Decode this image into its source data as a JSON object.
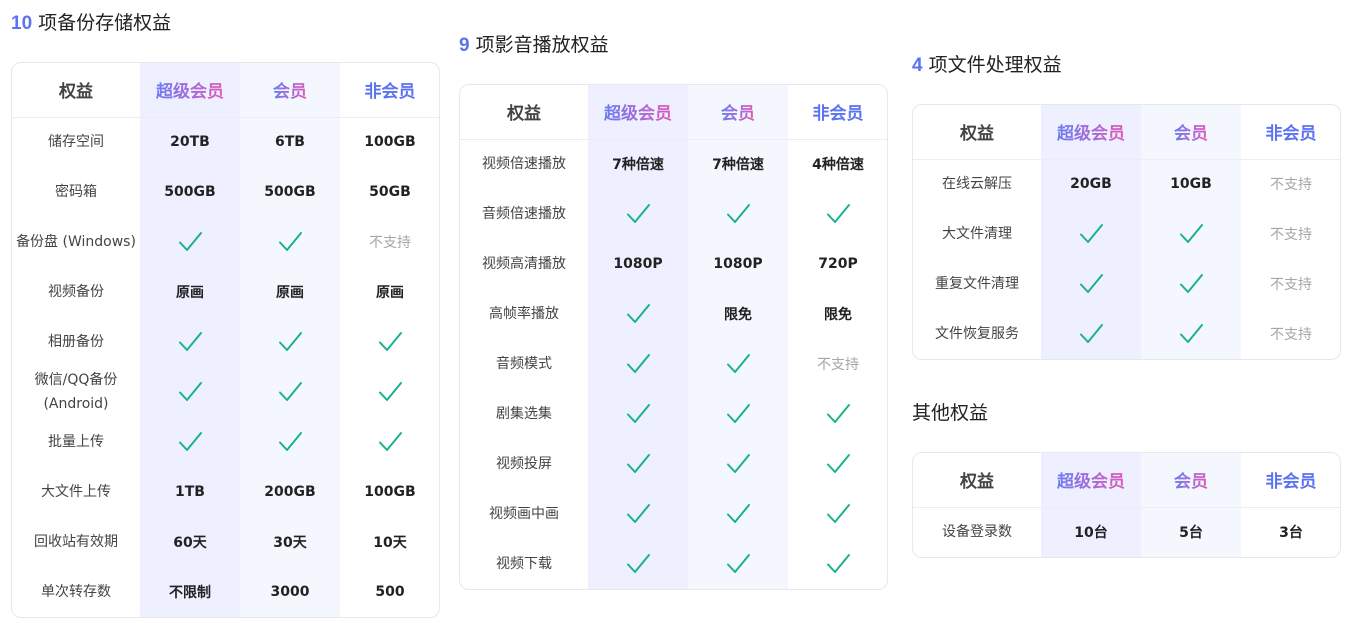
{
  "header": {
    "label": "权益",
    "super": "超级会员",
    "member": "会员",
    "nonmember": "非会员"
  },
  "sections": {
    "backup": {
      "num": "10",
      "title": "项备份存储权益",
      "rows": [
        {
          "label": "储存空间",
          "super": "20TB",
          "member": "6TB",
          "non": "100GB"
        },
        {
          "label": "密码箱",
          "super": "500GB",
          "member": "500GB",
          "non": "50GB"
        },
        {
          "label": "备份盘 (Windows)",
          "super": "check",
          "member": "check",
          "non": "不支持"
        },
        {
          "label": "视频备份",
          "super": "原画",
          "member": "原画",
          "non": "原画"
        },
        {
          "label": "相册备份",
          "super": "check",
          "member": "check",
          "non": "check"
        },
        {
          "label": "微信/QQ备份 (Android)",
          "super": "check",
          "member": "check",
          "non": "check"
        },
        {
          "label": "批量上传",
          "super": "check",
          "member": "check",
          "non": "check"
        },
        {
          "label": "大文件上传",
          "super": "1TB",
          "member": "200GB",
          "non": "100GB"
        },
        {
          "label": "回收站有效期",
          "super": "60天",
          "member": "30天",
          "non": "10天"
        },
        {
          "label": "单次转存数",
          "super": "不限制",
          "member": "3000",
          "non": "500"
        }
      ]
    },
    "media": {
      "num": "9",
      "title": "项影音播放权益",
      "rows": [
        {
          "label": "视频倍速播放",
          "super": "7种倍速",
          "member": "7种倍速",
          "non": "4种倍速"
        },
        {
          "label": "音频倍速播放",
          "super": "check",
          "member": "check",
          "non": "check"
        },
        {
          "label": "视频高清播放",
          "super": "1080P",
          "member": "1080P",
          "non": "720P"
        },
        {
          "label": "高帧率播放",
          "super": "check",
          "member": "限免",
          "non": "限免"
        },
        {
          "label": "音频模式",
          "super": "check",
          "member": "check",
          "non": "不支持"
        },
        {
          "label": "剧集选集",
          "super": "check",
          "member": "check",
          "non": "check"
        },
        {
          "label": "视频投屏",
          "super": "check",
          "member": "check",
          "non": "check"
        },
        {
          "label": "视频画中画",
          "super": "check",
          "member": "check",
          "non": "check"
        },
        {
          "label": "视频下载",
          "super": "check",
          "member": "check",
          "non": "check"
        }
      ]
    },
    "files": {
      "num": "4",
      "title": "项文件处理权益",
      "rows": [
        {
          "label": "在线云解压",
          "super": "20GB",
          "member": "10GB",
          "non": "不支持"
        },
        {
          "label": "大文件清理",
          "super": "check",
          "member": "check",
          "non": "不支持"
        },
        {
          "label": "重复文件清理",
          "super": "check",
          "member": "check",
          "non": "不支持"
        },
        {
          "label": "文件恢复服务",
          "super": "check",
          "member": "check",
          "non": "不支持"
        }
      ]
    },
    "other": {
      "num": "",
      "title": "其他权益",
      "rows": [
        {
          "label": "设备登录数",
          "super": "10台",
          "member": "5台",
          "non": "3台"
        }
      ]
    }
  },
  "colors": {
    "accent": "#5b72f2",
    "check": "#19b28c",
    "super_col": "#eef0ff",
    "member_col": "#f5f7ff",
    "na": "#a6a6a6"
  },
  "icons": {
    "check": "check-icon"
  }
}
